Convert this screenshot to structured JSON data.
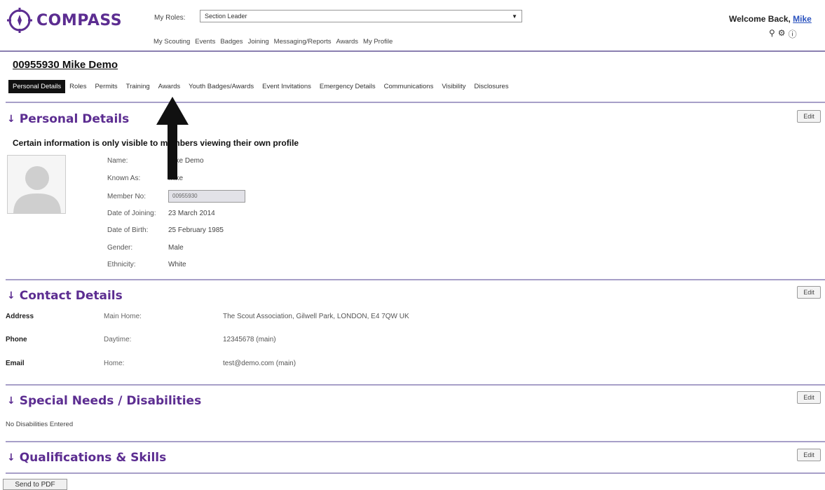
{
  "app": {
    "logo_text": "COMPASS",
    "accent_color": "#5c2d91"
  },
  "header": {
    "roles_label": "My Roles:",
    "roles_selected": "Section Leader",
    "nav": [
      "My Scouting",
      "Events",
      "Badges",
      "Joining",
      "Messaging/Reports",
      "Awards",
      "My Profile"
    ],
    "welcome_text": "Welcome Back,",
    "welcome_user": "Mike",
    "icons": [
      "search-icon",
      "gear-icon",
      "info-icon"
    ]
  },
  "member": {
    "title": "00955930 Mike Demo"
  },
  "tabs": [
    {
      "label": "Personal Details",
      "active": true
    },
    {
      "label": "Roles",
      "active": false
    },
    {
      "label": "Permits",
      "active": false
    },
    {
      "label": "Training",
      "active": false
    },
    {
      "label": "Awards",
      "active": false
    },
    {
      "label": "Youth Badges/Awards",
      "active": false
    },
    {
      "label": "Event Invitations",
      "active": false
    },
    {
      "label": "Emergency Details",
      "active": false
    },
    {
      "label": "Communications",
      "active": false
    },
    {
      "label": "Visibility",
      "active": false
    },
    {
      "label": "Disclosures",
      "active": false
    }
  ],
  "personal": {
    "heading": "Personal Details",
    "edit_label": "Edit",
    "notice": "Certain information is only visible to members viewing their own profile",
    "fields": [
      {
        "label": "Name:",
        "value": "Mike Demo"
      },
      {
        "label": "Known As:",
        "value": "Mike"
      },
      {
        "label": "Member No:",
        "value": "00955930"
      },
      {
        "label": "Date of Joining:",
        "value": "23 March 2014"
      },
      {
        "label": "Date of Birth:",
        "value": "25 February 1985"
      },
      {
        "label": "Gender:",
        "value": "Male"
      },
      {
        "label": "Ethnicity:",
        "value": "White"
      }
    ]
  },
  "contact": {
    "heading": "Contact Details",
    "edit_label": "Edit",
    "rows": [
      {
        "type": "Address",
        "sub": "Main Home:",
        "value": "The Scout Association, Gilwell Park, LONDON, E4 7QW UK"
      },
      {
        "type": "Phone",
        "sub": "Daytime:",
        "value": "12345678 (main)"
      },
      {
        "type": "Email",
        "sub": "Home:",
        "value": "test@demo.com (main)"
      }
    ]
  },
  "special": {
    "heading": "Special Needs / Disabilities",
    "edit_label": "Edit",
    "text": "No Disabilities Entered"
  },
  "qualifications": {
    "heading": "Qualifications & Skills",
    "edit_label": "Edit"
  },
  "footer": {
    "pdf_label": "Send to PDF"
  }
}
